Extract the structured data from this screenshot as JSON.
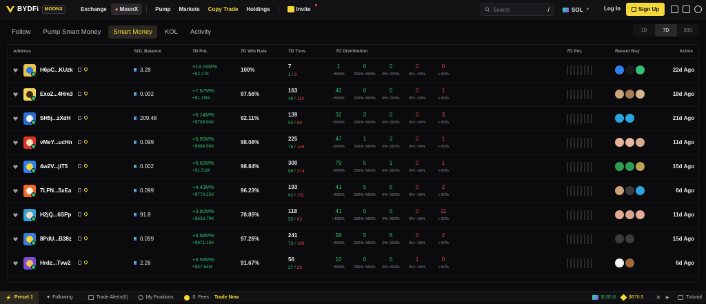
{
  "header": {
    "logo_text": "BYDFi",
    "logo_badge": "MOONX",
    "nav": [
      "Exchange",
      "MoonX",
      "Pump",
      "Markets",
      "Copy Trade",
      "Holdings"
    ],
    "invite": "Invite",
    "search_placeholder": "Search",
    "search_shortcut": "/",
    "chain": "SOL",
    "login": "Log In",
    "signup": "Sign Up",
    "accent": "#f4d73a"
  },
  "subtabs": [
    "Follow",
    "Pump Smart Money",
    "Smart Money",
    "KOL",
    "Activity"
  ],
  "active_subtab": "Smart Money",
  "range": [
    "1D",
    "7D",
    "30D"
  ],
  "active_range": "7D",
  "columns": {
    "address": "Address",
    "balance": "SOL Balance",
    "pnl": "7D PnL",
    "winrate": "7D Win Rate",
    "txns": "7D Txns",
    "dist": "7D Distribution",
    "pnl_chart": "7D PnL",
    "recent": "Recent Buy",
    "active": "Active"
  },
  "dist_labels": [
    ">500%",
    "200%~500%",
    "0%~200%",
    "0%~-50%",
    "<-50%"
  ],
  "rows": [
    {
      "addr": "H6pC...KUzk",
      "bal": "3.28",
      "pnl_pct": "+13.16M%",
      "pnl_usd": "+$2.27K",
      "wr": "100%",
      "tx": "7",
      "buy": "1",
      "sell": "6",
      "dist": [
        "1",
        "0",
        "0",
        "0",
        "0"
      ],
      "active": "22d Ago"
    },
    {
      "addr": "Exo2...4Hm3",
      "bal": "0.002",
      "pnl_pct": "+7.67M%",
      "pnl_usd": "+$1.15M",
      "wr": "97.56%",
      "tx": "163",
      "buy": "49",
      "sell": "114",
      "dist": [
        "40",
        "0",
        "0",
        "0",
        "1"
      ],
      "active": "18d Ago"
    },
    {
      "addr": "SH5j...zXdH",
      "bal": "209.48",
      "pnl_pct": "+6.14M%",
      "pnl_usd": "+$799.94K",
      "wr": "92.11%",
      "tx": "139",
      "buy": "50",
      "sell": "89",
      "dist": [
        "32",
        "3",
        "0",
        "0",
        "3"
      ],
      "active": "21d Ago"
    },
    {
      "addr": "vMeY...ucHn",
      "bal": "0.099",
      "pnl_pct": "+5.90M%",
      "pnl_usd": "+$984.96K",
      "wr": "98.08%",
      "tx": "225",
      "buy": "76",
      "sell": "149",
      "dist": [
        "47",
        "1",
        "3",
        "0",
        "1"
      ],
      "active": "11d Ago"
    },
    {
      "addr": "4w2V...jiT5",
      "bal": "0.002",
      "pnl_pct": "+5.02M%",
      "pnl_usd": "+$1.51M",
      "wr": "98.84%",
      "tx": "300",
      "buy": "86",
      "sell": "214",
      "dist": [
        "79",
        "5",
        "1",
        "0",
        "1"
      ],
      "active": "15d Ago"
    },
    {
      "addr": "7LFN...5xEa",
      "bal": "0.099",
      "pnl_pct": "+4.43M%",
      "pnl_usd": "+$770.25K",
      "wr": "96.23%",
      "tx": "193",
      "buy": "62",
      "sell": "131",
      "dist": [
        "41",
        "5",
        "5",
        "0",
        "2"
      ],
      "active": "6d Ago"
    },
    {
      "addr": "H2jQ...6SPp",
      "bal": "91.8",
      "pnl_pct": "+3.80M%",
      "pnl_usd": "+$633.79K",
      "wr": "78.85%",
      "tx": "118",
      "buy": "55",
      "sell": "63",
      "dist": [
        "41",
        "0",
        "0",
        "0",
        "11"
      ],
      "active": "11d Ago"
    },
    {
      "addr": "8PdU...B38z",
      "bal": "0.099",
      "pnl_pct": "+3.68M%",
      "pnl_usd": "+$971.18K",
      "wr": "97.26%",
      "tx": "241",
      "buy": "73",
      "sell": "168",
      "dist": [
        "58",
        "5",
        "8",
        "0",
        "2"
      ],
      "active": "15d Ago"
    },
    {
      "addr": "Hrdz...Tvw2",
      "bal": "2.26",
      "pnl_pct": "+3.58M%",
      "pnl_usd": "+$47.64M",
      "wr": "91.67%",
      "tx": "56",
      "buy": "27",
      "sell": "29",
      "dist": [
        "10",
        "0",
        "0",
        "1",
        "0"
      ],
      "active": "6d Ago"
    }
  ],
  "bottom": {
    "preset": "Preset 1",
    "following": "Following",
    "alerts": "Trade Alerts(0)",
    "positions": "My Positions",
    "fees_count": "0",
    "fees": "Fees",
    "trade_now": "Trade Now",
    "price1": "$165.8",
    "price2": "$670.5",
    "tutorial": "Tutorial"
  }
}
